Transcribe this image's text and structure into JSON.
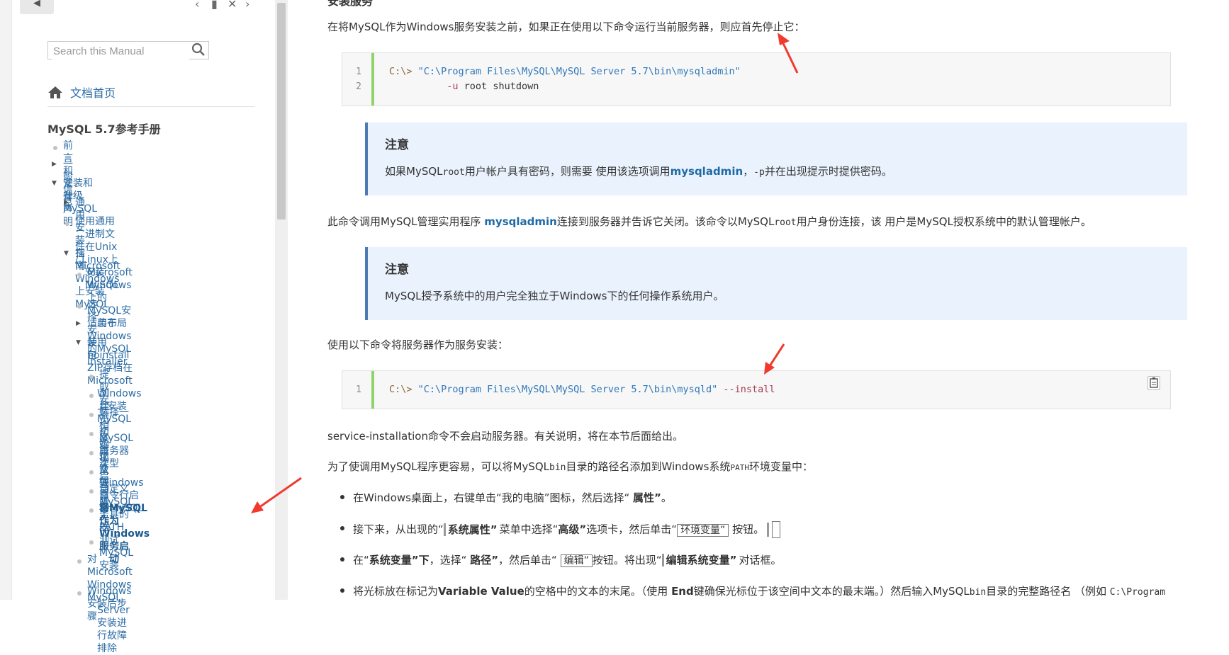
{
  "toolbar": {
    "back_label": "◀",
    "prev_label": "‹",
    "book_label": "▮",
    "close_label": "✕",
    "next_label": "›"
  },
  "search": {
    "placeholder": "Search this Manual",
    "value": ""
  },
  "home": {
    "label": "文档首页"
  },
  "manual_title": "MySQL 5.7参考手册",
  "toc": [
    {
      "label": "前言和法律声明",
      "marker": "dot"
    },
    {
      "label": "一般信息",
      "marker": "collapsed"
    },
    {
      "label": "安装和升级MySQL",
      "marker": "expanded"
    },
    {
      "label": "通用安装指南",
      "marker": "collapsed"
    },
    {
      "label_line1": "使用通用二进制文件在Unix / Linux上",
      "label_line2": "安装MySQL",
      "marker": "dot"
    },
    {
      "label": "在Microsoft Windows上安装MySQL",
      "marker": "expanded"
    },
    {
      "label_line1": "Microsoft Windows上的MySQL安",
      "label_line2": "装布局",
      "marker": "dot"
    },
    {
      "label": "选择安装包",
      "marker": "dot"
    },
    {
      "label": "适用于Windows的MySQL Installer",
      "marker": "collapsed"
    },
    {
      "label_line1": "使用noinstall ZIP存档在Microsoft",
      "label_line2": "Windows上安装MySQL",
      "marker": "expanded"
    },
    {
      "label": "提取安装档案",
      "marker": "dot"
    },
    {
      "label": "创建一个选项文件",
      "marker": "dot"
    },
    {
      "label": "选择一个MySQL服务器类型",
      "marker": "dot"
    },
    {
      "label": "初始化数据目录",
      "marker": "dot"
    },
    {
      "label": "首次启动服务器",
      "marker": "dot"
    },
    {
      "label": "从Windows命令行启动MySQL",
      "marker": "dot"
    },
    {
      "label": "自定义MySQL工具的PATH",
      "marker": "dot"
    },
    {
      "label_line1": "将MySQL作为Windows服务启",
      "label_line2": "动",
      "marker": "dot",
      "active": true
    },
    {
      "label": "测试MySQL安装",
      "marker": "dot"
    },
    {
      "label_line1": "对Microsoft Windows MySQL",
      "label_line2": "Server安装进行故障排除",
      "marker": "dot"
    },
    {
      "label": "Windows安装后步骤",
      "marker": "dot"
    }
  ],
  "content": {
    "section_title": "安装服务",
    "p1": "在将MySQL作为Windows服务安装之前，如果正在使用以下命令运行当前服务器，则应首先停止它：",
    "code1": {
      "line_numbers": [
        "1",
        "2"
      ],
      "prompt": "C:\\> ",
      "path": "\"C:\\Program Files\\MySQL\\MySQL Server 5.7\\bin\\mysqladmin\"",
      "line2_indent": "          ",
      "opt": "-u",
      "rest": " root shutdown"
    },
    "note1": {
      "title": "注意",
      "pre": "如果MySQL",
      "code": "root",
      "mid": "用户帐户具有密码，则需要 使用该选项调用",
      "cmd": "mysqladmin",
      "sep": "，",
      "code2": "-p",
      "post": "并在出现提示时提供密码。"
    },
    "p2": {
      "pre": "此命令调用MySQL管理实用程序 ",
      "cmd": "mysqladmin",
      "mid": "连接到服务器并告诉它关闭。该命令以MySQL",
      "code": "root",
      "post": "用户身份连接，该 用户是MySQL授权系统中的默认管理帐户。"
    },
    "note2": {
      "title": "注意",
      "body": "MySQL授予系统中的用户完全独立于Windows下的任何操作系统用户。"
    },
    "p3": "使用以下命令将服务器作为服务安装：",
    "code2": {
      "line_numbers": [
        "1"
      ],
      "prompt": "C:\\> ",
      "path": "\"C:\\Program Files\\MySQL\\MySQL Server 5.7\\bin\\mysqld\"",
      "opt": " --install"
    },
    "p4": "service-installation命令不会启动服务器。有关说明，将在本节后面给出。",
    "p5": {
      "pre": "为了使调用MySQL程序更容易，可以将MySQL",
      "code": "bin",
      "mid": "目录的路径名添加到Windows系统",
      "code2": "PATH",
      "post": "环境变量中："
    },
    "bullets": {
      "b1_pre": "在Windows桌面上，右键单击“我的电脑”图标，然后选择“ ",
      "b1_gui": "属性”",
      "b1_post": "。",
      "b2_pre": "接下来，从出现的“",
      "b2_gui": "系统属性”",
      "b2_mid": "菜单中选择“",
      "b2_tab": "高级”",
      "b2_mid2": "选项卡，然后单击“",
      "b2_btn": "环境变量”",
      "b2_post": " 按钮。",
      "b3_pre": "在“",
      "b3_gui": "系统变量”下",
      "b3_mid": "，选择“ ",
      "b3_path": "路径”",
      "b3_mid2": "，然后单击“ ",
      "b3_btn": "编辑”",
      "b3_mid3": "按钮。将出现“",
      "b3_dlg": "编辑系统变量”",
      "b3_post": "对话框。",
      "b4_pre": "将光标放在标记为",
      "b4_b1": "Variable Value",
      "b4_mid": "的空格中的文本的末尾。（使用 ",
      "b4_b2": "End",
      "b4_mid2": "键确保光标位于该空间中文本的最末端。）然后输入MySQL",
      "b4_code": "bin",
      "b4_post": "目录的完整路径名 （例如 ",
      "b4_code2": "C:\\Program"
    }
  },
  "colors": {
    "link": "#2d6da5",
    "note_bg": "#eaf3fd",
    "note_border": "#4c7bb3",
    "code_gutter": "#8fd36b",
    "annotation_arrow": "#f03a2e"
  }
}
